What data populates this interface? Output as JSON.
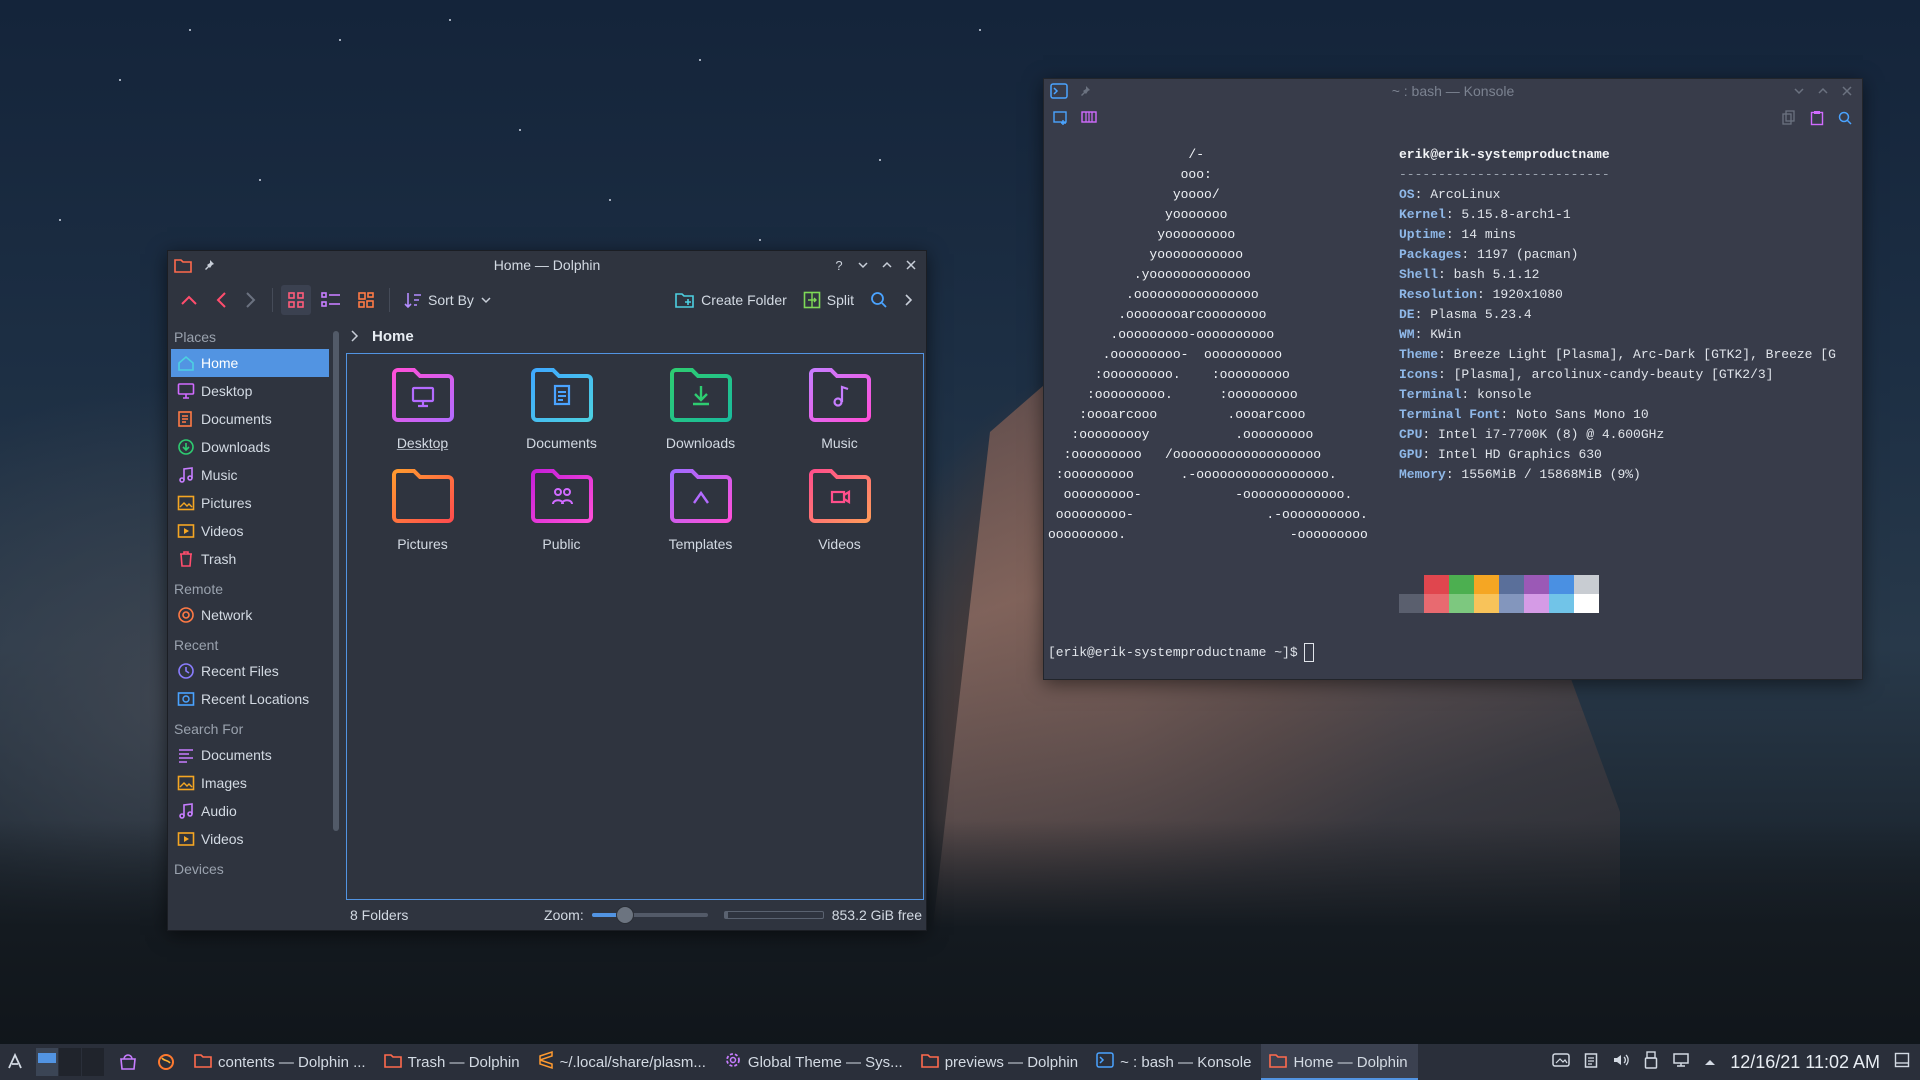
{
  "dolphin": {
    "title": "Home — Dolphin",
    "toolbar": {
      "sort_by": "Sort By",
      "create_folder": "Create Folder",
      "split": "Split"
    },
    "places": {
      "sections": [
        {
          "title": "Places",
          "items": [
            {
              "label": "Home",
              "icon": "home-icon",
              "active": true
            },
            {
              "label": "Desktop",
              "icon": "desktop-icon"
            },
            {
              "label": "Documents",
              "icon": "documents-icon"
            },
            {
              "label": "Downloads",
              "icon": "downloads-icon"
            },
            {
              "label": "Music",
              "icon": "music-icon"
            },
            {
              "label": "Pictures",
              "icon": "pictures-icon"
            },
            {
              "label": "Videos",
              "icon": "videos-icon"
            },
            {
              "label": "Trash",
              "icon": "trash-icon"
            }
          ]
        },
        {
          "title": "Remote",
          "items": [
            {
              "label": "Network",
              "icon": "network-icon"
            }
          ]
        },
        {
          "title": "Recent",
          "items": [
            {
              "label": "Recent Files",
              "icon": "recent-files-icon"
            },
            {
              "label": "Recent Locations",
              "icon": "recent-locations-icon"
            }
          ]
        },
        {
          "title": "Search For",
          "items": [
            {
              "label": "Documents",
              "icon": "search-documents-icon"
            },
            {
              "label": "Images",
              "icon": "images-icon"
            },
            {
              "label": "Audio",
              "icon": "audio-icon"
            },
            {
              "label": "Videos",
              "icon": "search-videos-icon"
            }
          ]
        },
        {
          "title": "Devices",
          "items": []
        }
      ]
    },
    "breadcrumb": "Home",
    "folders": [
      {
        "label": "Desktop",
        "icon": "desktop-folder-icon",
        "current": true
      },
      {
        "label": "Documents",
        "icon": "documents-folder-icon"
      },
      {
        "label": "Downloads",
        "icon": "downloads-folder-icon"
      },
      {
        "label": "Music",
        "icon": "music-folder-icon"
      },
      {
        "label": "Pictures",
        "icon": "pictures-folder-icon"
      },
      {
        "label": "Public",
        "icon": "public-folder-icon"
      },
      {
        "label": "Templates",
        "icon": "templates-folder-icon"
      },
      {
        "label": "Videos",
        "icon": "videos-folder-icon"
      }
    ],
    "status": {
      "count": "8 Folders",
      "zoom_label": "Zoom:",
      "zoom_level": 0.28,
      "free_space": "853.2 GiB free",
      "disk_used_fraction": 0.03
    }
  },
  "konsole": {
    "title": "~ : bash — Konsole",
    "ascii_art": [
      "                  /-",
      "                 ooo:",
      "                yoooo/",
      "               yooooooo",
      "              yooooooooo",
      "             yooooooooooo",
      "           .yooooooooooooo",
      "          .oooooooooooooooo",
      "         .oooooooarcoooooooo",
      "        .ooooooooo-oooooooooo",
      "       .ooooooooo-  oooooooooo",
      "      :ooooooooo.    :ooooooooo",
      "     :ooooooooo.      :ooooooooo",
      "    :oooarcooo         .oooarcooo",
      "   :ooooooooy           .ooooooooo",
      "  :ooooooooo   /ooooooooooooooooooo",
      " :ooooooooo      .-ooooooooooooooooo.",
      "  ooooooooo-            -ooooooooooooo.",
      " ooooooooo-                 .-oooooooooo.",
      "ooooooooo.                     -ooooooooo"
    ],
    "user_host": "erik@erik-systemproductname",
    "divider": "---------------------------",
    "info": [
      {
        "key": "OS",
        "value": "ArcoLinux"
      },
      {
        "key": "Kernel",
        "value": "5.15.8-arch1-1"
      },
      {
        "key": "Uptime",
        "value": "14 mins"
      },
      {
        "key": "Packages",
        "value": "1197 (pacman)"
      },
      {
        "key": "Shell",
        "value": "bash 5.1.12"
      },
      {
        "key": "Resolution",
        "value": "1920x1080"
      },
      {
        "key": "DE",
        "value": "Plasma 5.23.4"
      },
      {
        "key": "WM",
        "value": "KWin"
      },
      {
        "key": "Theme",
        "value": "Breeze Light [Plasma], Arc-Dark [GTK2], Breeze [G"
      },
      {
        "key": "Icons",
        "value": "[Plasma], arcolinux-candy-beauty [GTK2/3]"
      },
      {
        "key": "Terminal",
        "value": "konsole"
      },
      {
        "key": "Terminal Font",
        "value": "Noto Sans Mono 10"
      },
      {
        "key": "CPU",
        "value": "Intel i7-7700K (8) @ 4.600GHz"
      },
      {
        "key": "GPU",
        "value": "Intel HD Graphics 630"
      },
      {
        "key": "Memory",
        "value": "1556MiB / 15868MiB (9%)"
      }
    ],
    "palette_top": [
      "#383c4a",
      "#e0464e",
      "#4caf50",
      "#f5a623",
      "#5a6f9a",
      "#9b59b6",
      "#4a90e2",
      "#c8ccd2"
    ],
    "palette_bottom": [
      "#5a5f6e",
      "#e86a70",
      "#7dc87f",
      "#f8c35a",
      "#8396bd",
      "#d59be6",
      "#71c4e8",
      "#ffffff"
    ],
    "prompt": "[erik@erik-systemproductname ~]$"
  },
  "taskbar": {
    "tasks": [
      {
        "label": "contents — Dolphin ...",
        "icon": "dolphin-icon"
      },
      {
        "label": "Trash — Dolphin",
        "icon": "dolphin-icon"
      },
      {
        "label": "~/.local/share/plasm...",
        "icon": "sublime-icon"
      },
      {
        "label": "Global Theme — Sys...",
        "icon": "system-settings-icon"
      },
      {
        "label": "previews — Dolphin",
        "icon": "dolphin-icon"
      },
      {
        "label": "~ : bash — Konsole",
        "icon": "konsole-icon"
      },
      {
        "label": "Home — Dolphin",
        "icon": "dolphin-icon",
        "active": true
      }
    ],
    "clock": "12/16/21 11:02 AM"
  },
  "colors": {
    "accent": "#5294e2",
    "window_bg": "#2f343f",
    "terminal_bg": "#383c4a",
    "panel_bg": "#2a2f3a"
  }
}
